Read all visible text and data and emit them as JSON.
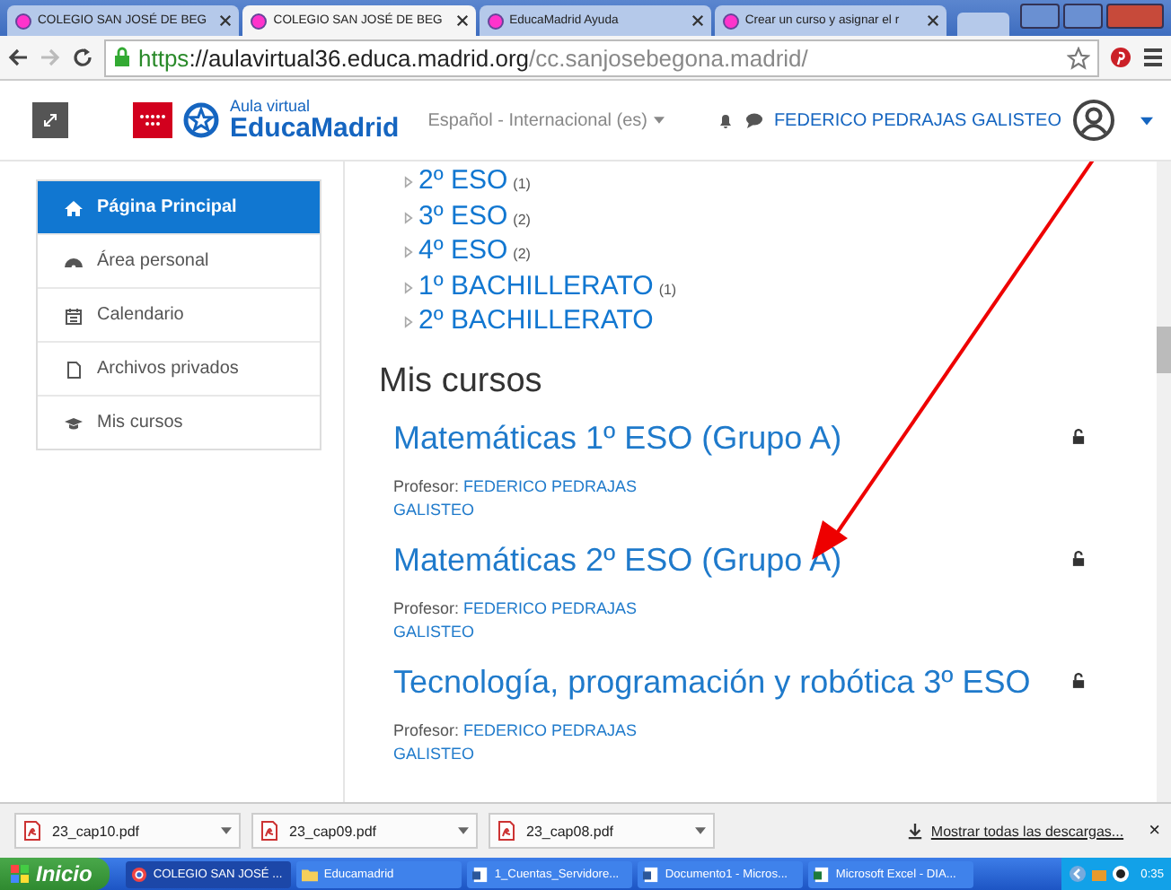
{
  "browser": {
    "tabs": [
      {
        "title": "COLEGIO SAN JOSÉ DE BEG",
        "selected": false
      },
      {
        "title": "COLEGIO SAN JOSÉ DE BEG",
        "selected": true
      },
      {
        "title": "EducaMadrid Ayuda",
        "selected": false
      },
      {
        "title": "Crear un curso y asignar el r",
        "selected": false
      }
    ],
    "url": {
      "scheme": "https",
      "domain": "://aulavirtual36.educa.madrid.org",
      "path": "/cc.sanjosebegona.madrid/"
    }
  },
  "header": {
    "logo_small": "Aula virtual",
    "logo_big": "EducaMadrid",
    "language": "Español - Internacional (es)",
    "user": "FEDERICO PEDRAJAS GALISTEO"
  },
  "sidebar": {
    "items": [
      {
        "label": "Página Principal",
        "selected": true
      },
      {
        "label": "Área personal",
        "selected": false
      },
      {
        "label": "Calendario",
        "selected": false
      },
      {
        "label": "Archivos privados",
        "selected": false
      },
      {
        "label": "Mis cursos",
        "selected": false
      }
    ]
  },
  "categories": [
    {
      "name": "2º ESO",
      "count": "(1)"
    },
    {
      "name": "3º ESO",
      "count": "(2)"
    },
    {
      "name": "4º ESO",
      "count": "(2)"
    },
    {
      "name": "1º BACHILLERATO",
      "count": "(1)"
    },
    {
      "name": "2º BACHILLERATO"
    }
  ],
  "my_courses": {
    "heading": "Mis cursos",
    "courses": [
      {
        "title": "Matemáticas 1º ESO (Grupo A)",
        "teacher_label": "Profesor:",
        "teacher": "FEDERICO PEDRAJAS GALISTEO"
      },
      {
        "title": "Matemáticas 2º ESO (Grupo A)",
        "teacher_label": "Profesor:",
        "teacher": "FEDERICO PEDRAJAS GALISTEO"
      },
      {
        "title": "Tecnología, programación y robótica 3º ESO",
        "teacher_label": "Profesor:",
        "teacher": "FEDERICO PEDRAJAS GALISTEO"
      }
    ]
  },
  "downloads": {
    "files": [
      "23_cap10.pdf",
      "23_cap09.pdf",
      "23_cap08.pdf"
    ],
    "show_all": "Mostrar todas las descargas...",
    "close": "×"
  },
  "taskbar": {
    "start": "Inicio",
    "items": [
      {
        "label": "COLEGIO SAN JOSÉ ..."
      },
      {
        "label": "Educamadrid"
      },
      {
        "label": "1_Cuentas_Servidore..."
      },
      {
        "label": "Documento1 - Micros..."
      },
      {
        "label": "Microsoft Excel - DIA..."
      }
    ],
    "clock": "0:35"
  }
}
